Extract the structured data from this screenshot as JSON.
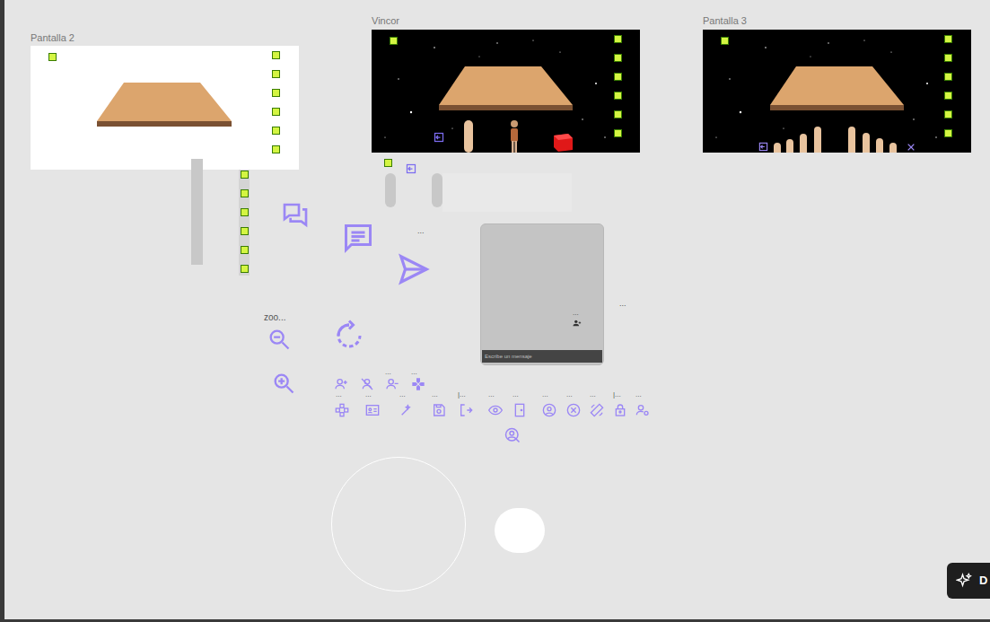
{
  "frames": [
    {
      "label": "Pantalla 2"
    },
    {
      "label": "Vincor"
    },
    {
      "label": "Pantalla 3"
    }
  ],
  "zoom_label": "zoo...",
  "chat_more": "...",
  "card": {
    "more": "...",
    "placeholder": "Escribe un mensaje"
  },
  "card_side_more": "...",
  "icon_labels": [
    "...",
    "...",
    "...",
    "...",
    "...",
    "...",
    "|...",
    "...",
    "...",
    "...",
    "...",
    "...",
    "|...",
    "..."
  ],
  "assistant_button": {
    "label": "D"
  }
}
